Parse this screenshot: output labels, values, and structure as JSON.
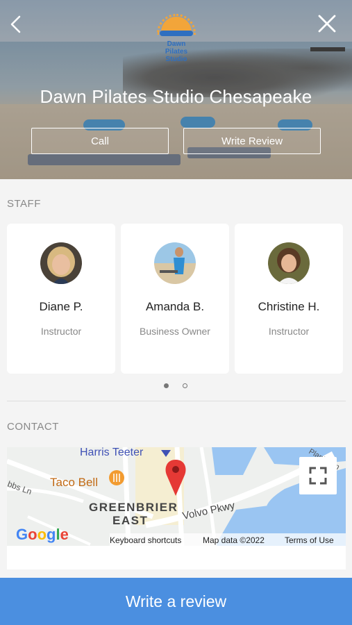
{
  "header": {
    "studio_name": "Dawn Pilates Studio Chesapeake",
    "logo_text": [
      "Dawn",
      "Pilates",
      "Studio"
    ],
    "call_label": "Call",
    "write_review_label": "Write Review"
  },
  "staff": {
    "section_label": "STAFF",
    "members": [
      {
        "name": "Diane P.",
        "role": "Instructor"
      },
      {
        "name": "Amanda B.",
        "role": "Business Owner"
      },
      {
        "name": "Christine H.",
        "role": "Instructor"
      }
    ],
    "pagination": {
      "current": 1,
      "total": 2
    }
  },
  "contact": {
    "section_label": "CONTACT",
    "map": {
      "labels": {
        "harris_teeter": "Harris Teeter",
        "taco_bell": "Taco Bell",
        "greenbrier_1": "GREENBRIER",
        "greenbrier_2": "EAST",
        "volvo": "Volvo Pkwy",
        "gibbs": "bbs Ln",
        "plantation": "Plantation"
      },
      "google_logo": "Google",
      "keyboard_shortcuts": "Keyboard shortcuts",
      "map_data": "Map data ©2022",
      "terms": "Terms of Use"
    }
  },
  "footer": {
    "write_review_label": "Write a review"
  },
  "colors": {
    "primary": "#4b8fe0",
    "map_water": "#9ac5f2",
    "pin": "#e53935"
  }
}
